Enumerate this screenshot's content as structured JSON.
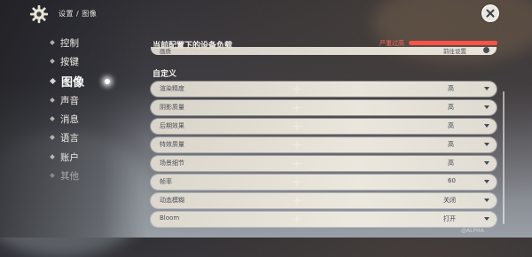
{
  "header": {
    "breadcrumb": "设置 / 图像"
  },
  "sidebar": {
    "items": [
      {
        "label": "控制"
      },
      {
        "label": "按键"
      },
      {
        "label": "图像"
      },
      {
        "label": "声音"
      },
      {
        "label": "消息"
      },
      {
        "label": "语言"
      },
      {
        "label": "账户"
      },
      {
        "label": "其他"
      }
    ],
    "active_index": 2
  },
  "device_load": {
    "title": "当前配置下的设备负载",
    "status": "严重过高",
    "status_color": "#ff5148"
  },
  "preset_row": {
    "label": "画质",
    "value": "前往设置"
  },
  "custom_section": {
    "title": "自定义",
    "rows": [
      {
        "label": "渲染精度",
        "value": "高"
      },
      {
        "label": "阴影质量",
        "value": "高"
      },
      {
        "label": "后期效果",
        "value": "高"
      },
      {
        "label": "特效质量",
        "value": "高"
      },
      {
        "label": "场景细节",
        "value": "高"
      },
      {
        "label": "帧率",
        "value": "60"
      },
      {
        "label": "动态模糊",
        "value": "关闭"
      },
      {
        "label": "Bloom",
        "value": "打开"
      }
    ]
  },
  "watermark": "@ALPHA"
}
